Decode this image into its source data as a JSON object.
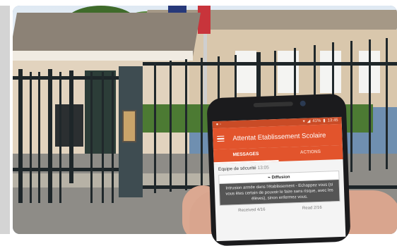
{
  "app": {
    "status_bar": {
      "time": "13:45",
      "battery": "41%"
    },
    "title": "Attentat Etablissement Scolaire",
    "tabs": [
      {
        "label": "MESSAGES"
      },
      {
        "label": "ACTIONS"
      }
    ],
    "message": {
      "sender": "Equipe de sécurité",
      "time": "13:05",
      "badge": "Diffusion",
      "text": "Intrusion armée dans l'établissement - Echappez vous (si vous êtes certain de pouvoir le faire sans risque, avec les élèves), sinon enfermez vous.",
      "received": "Received 4/16",
      "read": "Read 2/16"
    }
  },
  "colors": {
    "accent": "#e2542c",
    "status": "#c94b26"
  },
  "icons": [
    "menu-icon",
    "wifi-icon",
    "signal-icon",
    "battery-icon",
    "broadcast-icon"
  ]
}
